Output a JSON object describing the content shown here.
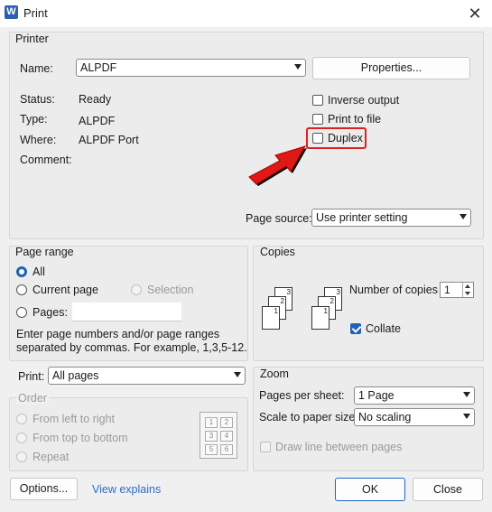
{
  "window": {
    "title": "Print",
    "app_icon_letter": "W"
  },
  "printer": {
    "group_title": "Printer",
    "name_label": "Name:",
    "name_value": "ALPDF",
    "properties_label": "Properties...",
    "status_label": "Status:",
    "status_value": "Ready",
    "type_label": "Type:",
    "type_value": "ALPDF",
    "where_label": "Where:",
    "where_value": "ALPDF Port",
    "comment_label": "Comment:",
    "comment_value": "",
    "inverse_output_label": "Inverse output",
    "print_to_file_label": "Print to file",
    "duplex_label": "Duplex",
    "page_source_label": "Page source:",
    "page_source_value": "Use printer setting",
    "highlight_color": "#e02020"
  },
  "page_range": {
    "group_title": "Page range",
    "all_label": "All",
    "current_page_label": "Current page",
    "selection_label": "Selection",
    "pages_label": "Pages:",
    "pages_value": "",
    "hint_line1": "Enter page numbers and/or page ranges",
    "hint_line2": "separated by commas. For example, 1,3,5-12."
  },
  "copies": {
    "group_title": "Copies",
    "number_label": "Number of copies",
    "number_value": "1",
    "collate_label": "Collate",
    "stack_labels": [
      "3",
      "2",
      "1"
    ]
  },
  "print_what": {
    "label": "Print:",
    "value": "All pages"
  },
  "order": {
    "group_title": "Order",
    "left_to_right": "From left to right",
    "top_to_bottom": "From top to bottom",
    "repeat": "Repeat",
    "grid": [
      "1",
      "2",
      "3",
      "4",
      "5",
      "6"
    ]
  },
  "zoom": {
    "group_title": "Zoom",
    "pages_per_sheet_label": "Pages per sheet:",
    "pages_per_sheet_value": "1 Page",
    "scale_label": "Scale to paper size:",
    "scale_value": "No scaling",
    "draw_lines_label": "Draw line between pages"
  },
  "footer": {
    "options_label": "Options...",
    "view_explains_label": "View explains",
    "ok_label": "OK",
    "close_label": "Close"
  },
  "accent_color": "#1f63b8"
}
